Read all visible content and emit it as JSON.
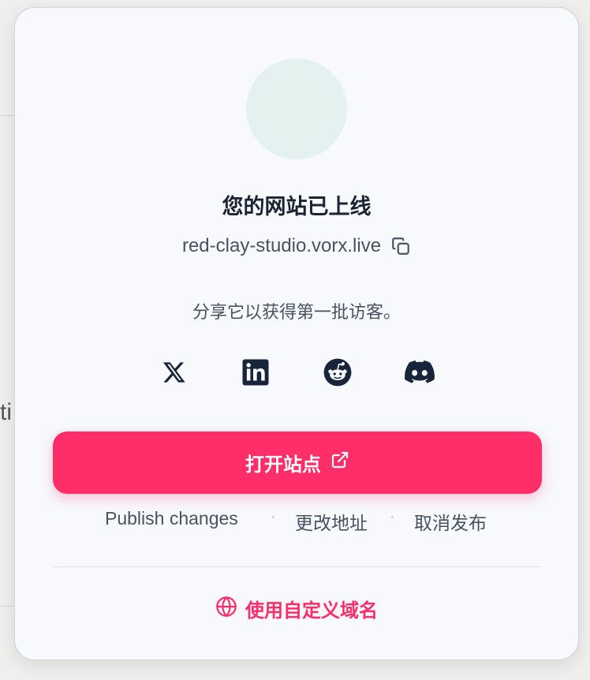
{
  "background": {
    "fragment_text": "ti"
  },
  "dialog": {
    "title": "您的网站已上线",
    "site_url": "red-clay-studio.vorx.live",
    "share_text": "分享它以获得第一批访客。",
    "social": [
      {
        "name": "x",
        "icon": "x-logo-icon"
      },
      {
        "name": "linkedin",
        "icon": "linkedin-icon"
      },
      {
        "name": "reddit",
        "icon": "reddit-icon"
      },
      {
        "name": "discord",
        "icon": "discord-icon"
      }
    ],
    "open_site_label": "打开站点",
    "actions": {
      "publish_changes": "Publish changes",
      "separator": "·",
      "change_address": "更改地址",
      "unpublish": "取消发布"
    },
    "custom_domain_label": "使用自定义域名"
  },
  "colors": {
    "accent": "#ff2e68",
    "card_bg": "#f7f9fc",
    "avatar_bg": "#e4f1ef",
    "text_dark": "#1b2433",
    "text_muted": "#475263",
    "icon_dark": "#17243a"
  }
}
